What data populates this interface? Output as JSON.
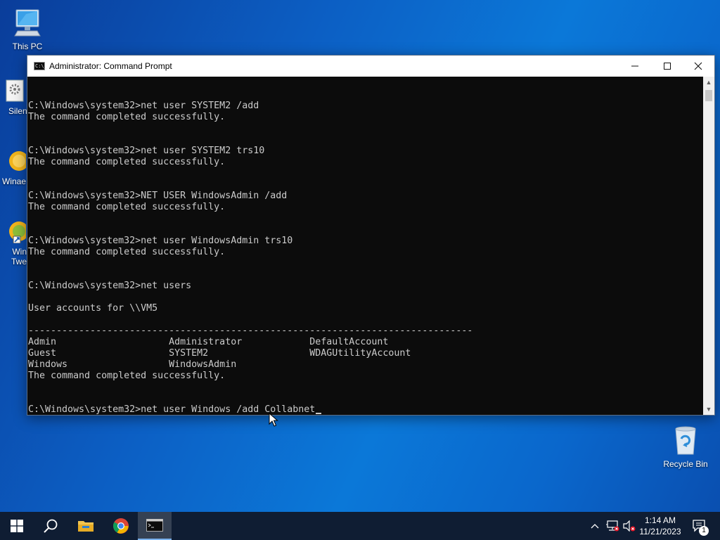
{
  "desktop": {
    "icons": [
      {
        "label": "This PC"
      },
      {
        "label": "Silent"
      },
      {
        "label": "Winae"
      },
      {
        "label": "Win\nTwe"
      },
      {
        "label": "Recycle Bin"
      }
    ]
  },
  "window": {
    "title": "Administrator: Command Prompt",
    "icon_text": "C:\\_"
  },
  "console": {
    "lines": [
      "",
      "",
      "C:\\Windows\\system32>net user SYSTEM2 /add",
      "The command completed successfully.",
      "",
      "",
      "C:\\Windows\\system32>net user SYSTEM2 trs10",
      "The command completed successfully.",
      "",
      "",
      "C:\\Windows\\system32>NET USER WindowsAdmin /add",
      "The command completed successfully.",
      "",
      "",
      "C:\\Windows\\system32>net user WindowsAdmin trs10",
      "The command completed successfully.",
      "",
      "",
      "C:\\Windows\\system32>net users",
      "",
      "User accounts for \\\\VM5",
      "",
      "-------------------------------------------------------------------------------",
      "Admin                    Administrator            DefaultAccount",
      "Guest                    SYSTEM2                  WDAGUtilityAccount",
      "Windows                  WindowsAdmin",
      "The command completed successfully.",
      "",
      "",
      "C:\\Windows\\system32>net user Windows /add Collabnet"
    ]
  },
  "taskbar": {
    "time": "1:14 AM",
    "date": "11/21/2023",
    "notification_count": "1",
    "apps": [
      "start-button",
      "search-button",
      "file-explorer",
      "chrome",
      "command-prompt"
    ]
  }
}
